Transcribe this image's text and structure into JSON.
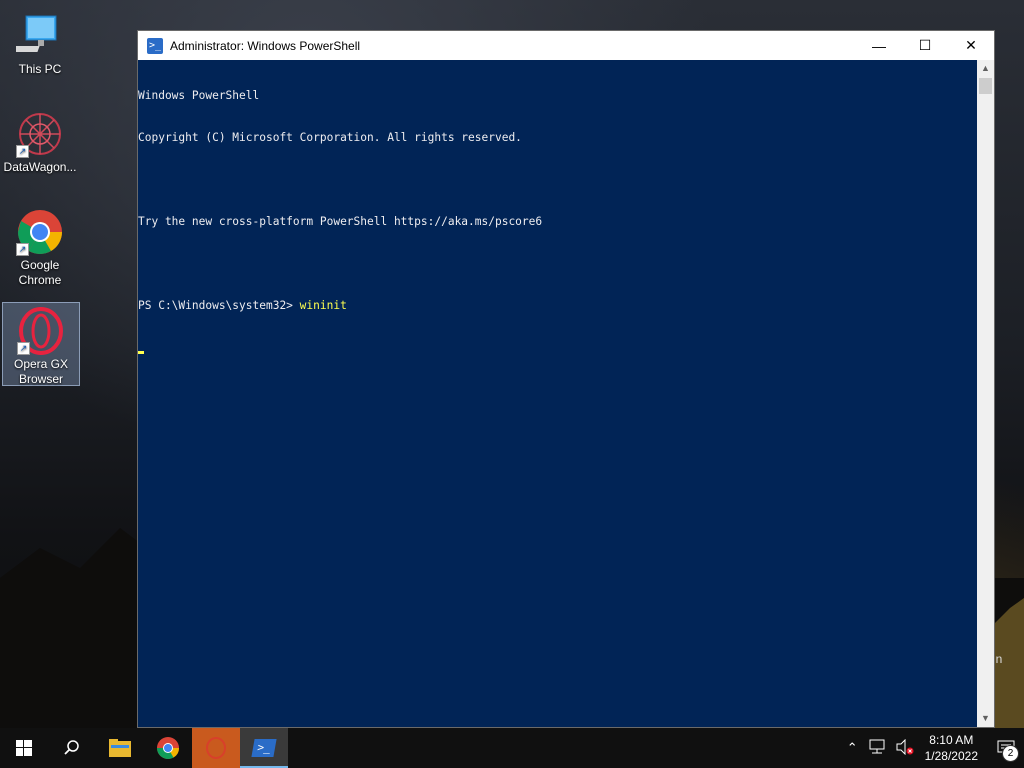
{
  "desktop": {
    "icons": [
      {
        "label": "This PC"
      },
      {
        "label": "DataWagon..."
      },
      {
        "label": "Google Chrome"
      },
      {
        "label": "Opera GX Browser"
      }
    ],
    "side_text": "in"
  },
  "window": {
    "title": "Administrator: Windows PowerShell",
    "minimize": "—",
    "maximize": "☐",
    "close": "✕"
  },
  "console": {
    "lines": [
      "Windows PowerShell",
      "Copyright (C) Microsoft Corporation. All rights reserved.",
      "",
      "Try the new cross-platform PowerShell https://aka.ms/pscore6",
      ""
    ],
    "prompt": "PS C:\\Windows\\system32> ",
    "command": "wininit"
  },
  "taskbar": {
    "time": "8:10 AM",
    "date": "1/28/2022",
    "notification_count": "2"
  },
  "colors": {
    "console_bg": "#012456",
    "console_fg": "#eeedf0",
    "command": "#ffff4f",
    "taskbar": "#101010"
  }
}
